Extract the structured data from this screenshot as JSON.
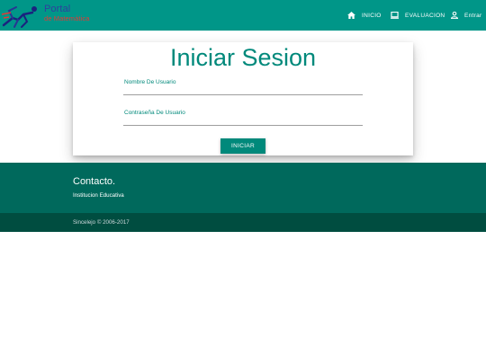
{
  "brand": {
    "line1": "Portal",
    "line2": "de Matemática"
  },
  "nav": {
    "items": [
      {
        "label": "INICIO",
        "icon": "home-icon"
      },
      {
        "label": "EVALUACION",
        "icon": "laptop-icon"
      },
      {
        "label": "Entrar",
        "icon": "person-icon"
      }
    ]
  },
  "login": {
    "title": "Iniciar Sesion",
    "username_label": "Nombre De Usuario",
    "username_value": "",
    "password_label": "Contraseña De Usuario",
    "password_value": "",
    "submit_label": "INICIAR"
  },
  "footer": {
    "title": "Contacto.",
    "text": "Institucion Educativa",
    "copyright": "Sincelejo © 2006-2017"
  },
  "colors": {
    "primary": "#009688",
    "accent": "#00897b",
    "footer": "#00695c",
    "footer_dark": "#004d40"
  }
}
